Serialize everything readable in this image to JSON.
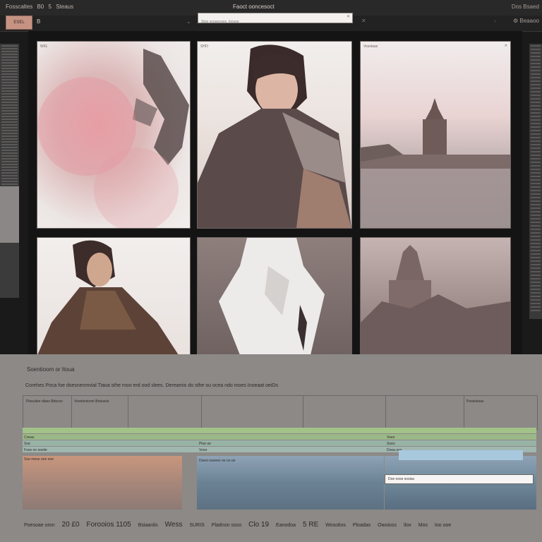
{
  "window": {
    "left_items": [
      "Fosscaltes",
      "B0",
      "5",
      "Steaus"
    ],
    "title": "Faoct ooncesoct",
    "right_text": "Dos Bsaed"
  },
  "toolbar": {
    "primary_label": "ESEL",
    "small_label": "B",
    "search_placeholder": "Stoo sooaoooes, loosoe",
    "right_text": "Beaaoo"
  },
  "grid": {
    "tiles": [
      {
        "num": "WIG"
      },
      {
        "num": "SHO"
      },
      {
        "num": "Vosstaas"
      },
      {
        "num": ""
      },
      {
        "num": ""
      },
      {
        "num": ""
      }
    ]
  },
  "bottom": {
    "title": "Soentioom or Itoua",
    "description": "Corehes Poca foe dsesnenmvial Tiaoa sthe moo erd ood slees. Dereamis do sthe ou ocea ndo moes Inoeaat oeiDs",
    "table_headers": [
      "Plenuiiee dlaes Bdocec",
      "Voeriieoioom Boieaels",
      "Poosioiaas"
    ],
    "rows_left": [
      "Coeas",
      "Soe",
      "Fose oo ooeiie",
      "Soe mese ooe ooe"
    ],
    "rows_mid": [
      "Ploe oe",
      "Vooo",
      "Doesi osoeeo oe oo oe"
    ],
    "rows_right": [
      "Voeo",
      "Soeo",
      "Doea oas"
    ],
    "selected": "Doe oose sosisa",
    "footer": [
      "Poesoae oron",
      "20 £0",
      "Forooios 1105",
      "Bsiaanlis",
      "Wess",
      "SURIS",
      "Pladnon ssoo",
      "Clo 19",
      "Eanodoa",
      "5 RE",
      "Wosotios",
      "Ploadas",
      "Owoioss",
      "Ilox",
      "Mos",
      "Ioo ooe"
    ]
  },
  "colors": {
    "background": "#1b1a1a",
    "accent_button": "#c69382",
    "panel": "#8c8987",
    "green_band": "#a3c289",
    "blue_band": "#8ea3b5",
    "tan_band": "#c8967c"
  }
}
